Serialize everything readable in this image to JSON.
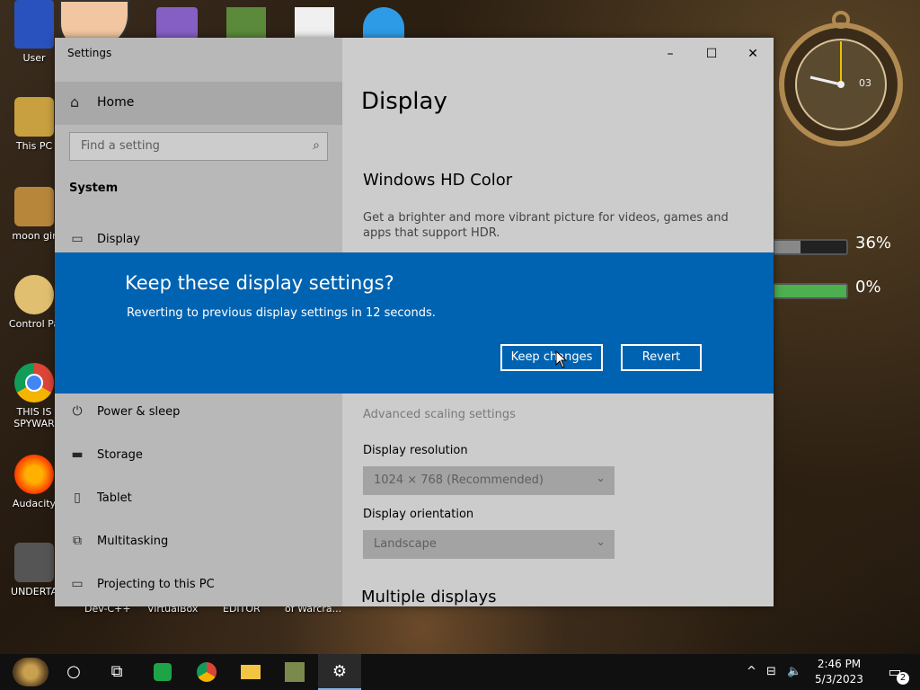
{
  "desktop": {
    "icons": [
      {
        "label": "User",
        "color": "#2a52be"
      },
      {
        "label": "This PC",
        "color": "#c8a040"
      },
      {
        "label": "moon gir",
        "color": "#b8863b"
      },
      {
        "label": "Control Pa",
        "color": "#e0c070"
      },
      {
        "label": "THIS IS SPYWAR",
        "color": "#4285f4"
      },
      {
        "label": "Audacity",
        "color": "#ff6a00"
      },
      {
        "label": "UNDERTA",
        "color": "#555555"
      }
    ],
    "bottom_labels": [
      "Dev-C++",
      "VirtualBox",
      "EDITOR",
      "of Warcra..."
    ],
    "top_icons": [
      "visual-studio-icon",
      "minecraft-icon",
      "swf-icon",
      "paint-icon"
    ],
    "gadget": {
      "meter1": "36%",
      "meter1_level": 0.36,
      "meter2": "0%",
      "meter2_level": 0.0,
      "clock_digits": "03"
    }
  },
  "settings": {
    "title": "Settings",
    "home": "Home",
    "search_placeholder": "Find a setting",
    "category": "System",
    "items": [
      {
        "label": "Display",
        "icon": "display-icon"
      },
      {
        "label": "Power & sleep",
        "icon": "power-icon"
      },
      {
        "label": "Storage",
        "icon": "storage-icon"
      },
      {
        "label": "Tablet",
        "icon": "tablet-icon"
      },
      {
        "label": "Multitasking",
        "icon": "multitasking-icon"
      },
      {
        "label": "Projecting to this PC",
        "icon": "projecting-icon"
      }
    ],
    "page_title": "Display",
    "hd_color_heading": "Windows HD Color",
    "hd_color_desc": "Get a brighter and more vibrant picture for videos, games and apps that support HDR.",
    "advanced_scaling": "Advanced scaling settings",
    "resolution_label": "Display resolution",
    "resolution_value": "1024 × 768 (Recommended)",
    "orientation_label": "Display orientation",
    "orientation_value": "Landscape",
    "multiple_displays": "Multiple displays"
  },
  "dialog": {
    "heading": "Keep these display settings?",
    "message": "Reverting to previous display settings in 12 seconds.",
    "keep_label": "Keep changes",
    "revert_label": "Revert"
  },
  "taskbar": {
    "time": "2:46 PM",
    "date": "5/3/2023",
    "notification_count": "2"
  },
  "colors": {
    "accent": "#0063b1",
    "taskbar": "#101010"
  }
}
